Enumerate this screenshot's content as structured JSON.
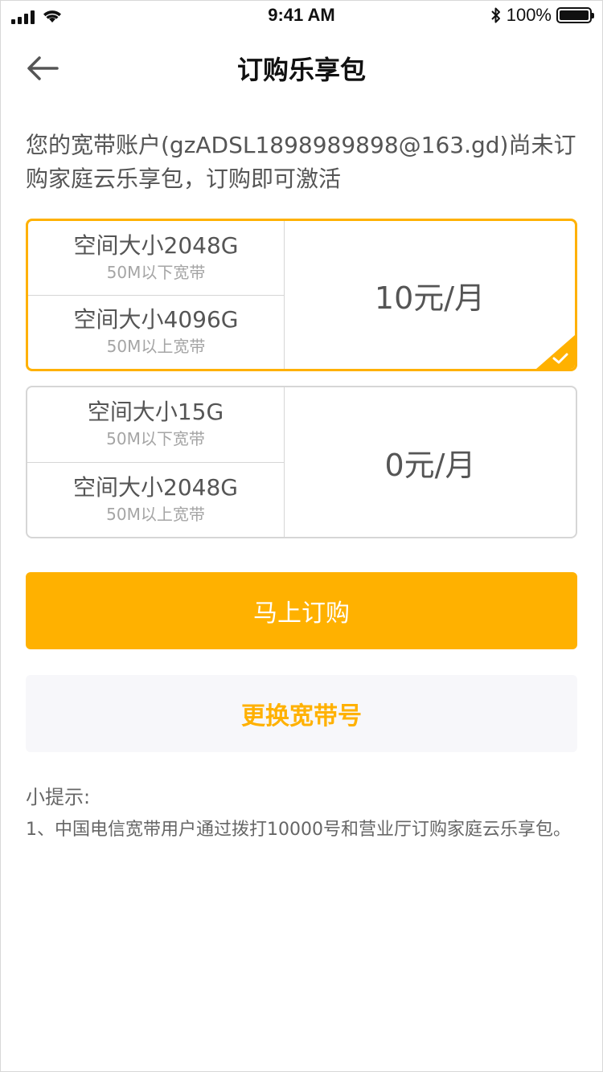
{
  "status_bar": {
    "time": "9:41 AM",
    "battery": "100%",
    "battery_level": 1.0
  },
  "nav": {
    "back_icon": "arrow-left-icon",
    "title": "订购乐享包"
  },
  "intro": {
    "text": "您的宽带账户(gzADSL1898989898@163.gd)尚未订购家庭云乐享包，订购即可激活"
  },
  "plans": [
    {
      "selected": true,
      "price": "10元/月",
      "tiers": [
        {
          "size": "空间大小2048G",
          "desc": "50M以下宽带"
        },
        {
          "size": "空间大小4096G",
          "desc": "50M以上宽带"
        }
      ]
    },
    {
      "selected": false,
      "price": "0元/月",
      "tiers": [
        {
          "size": "空间大小15G",
          "desc": "50M以下宽带"
        },
        {
          "size": "空间大小2048G",
          "desc": "50M以上宽带"
        }
      ]
    }
  ],
  "buttons": {
    "order_now": "马上订购",
    "change_account": "更换宽带号"
  },
  "tips": {
    "title": "小提示:",
    "items": [
      "1、中国电信宽带用户通过拨打10000号和营业厅订购家庭云乐享包。"
    ]
  },
  "colors": {
    "accent": "#FFB100",
    "border": "#D6D6D6",
    "secondary_bg": "#F7F7FA"
  }
}
